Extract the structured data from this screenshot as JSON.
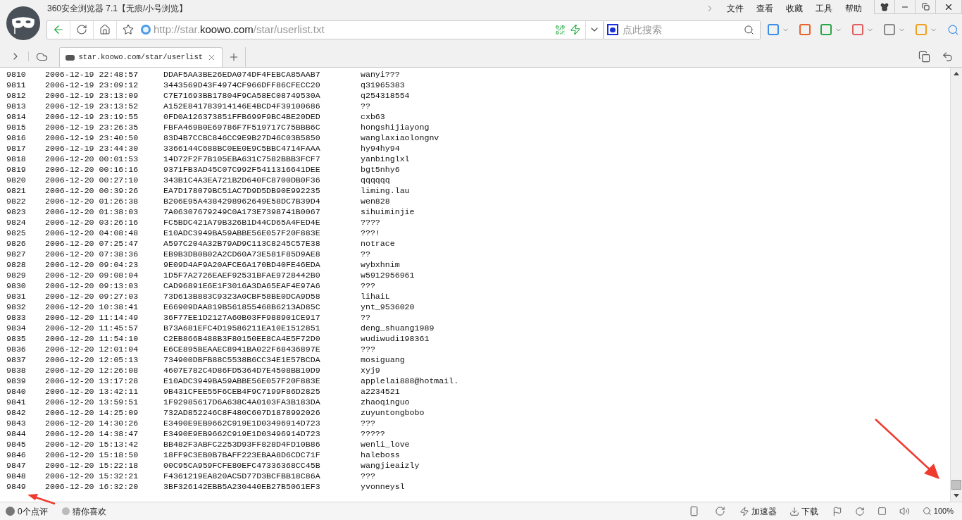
{
  "window": {
    "title": "360安全浏览器 7.1【无痕/小号浏览】"
  },
  "menu": [
    "文件",
    "查看",
    "收藏",
    "工具",
    "帮助"
  ],
  "address_bar": {
    "value_prefix": "http://star.",
    "value_domain": "koowo.com",
    "value_path": "/star/userlist.txt"
  },
  "search": {
    "placeholder": "点此搜索"
  },
  "tabs": [
    {
      "label": "star.koowo.com/star/userlist",
      "selected": true
    }
  ],
  "rows": [
    {
      "id": "9810",
      "time": "2006-12-19 22:48:57",
      "hash": "DDAF5AA3BE26EDA074DF4FEBCA85AAB7",
      "user": "wanyi???"
    },
    {
      "id": "9811",
      "time": "2006-12-19 23:09:12",
      "hash": "3443569D43F4974CF966DFF86CFECC20",
      "user": "q31965383"
    },
    {
      "id": "9812",
      "time": "2006-12-19 23:13:09",
      "hash": "C7E71693BB17804F9CA58EC08749530A",
      "user": "q254318554"
    },
    {
      "id": "9813",
      "time": "2006-12-19 23:13:52",
      "hash": "A152E841783914146E4BCD4F39100686",
      "user": "??"
    },
    {
      "id": "9814",
      "time": "2006-12-19 23:19:55",
      "hash": "0FD0A126373851FFB699F9BC4BE20DED",
      "user": "cxb63"
    },
    {
      "id": "9815",
      "time": "2006-12-19 23:26:35",
      "hash": "FBFA469B0E69786F7F519717C75BBB6C",
      "user": "hongshijiayong"
    },
    {
      "id": "9816",
      "time": "2006-12-19 23:40:50",
      "hash": "83D4B7CCBC846CC9E9B27D46C03B5850",
      "user": "wanglaxiaolongnv"
    },
    {
      "id": "9817",
      "time": "2006-12-19 23:44:30",
      "hash": "3366144C688BC0EE0E9C5BBC4714FAAA",
      "user": "hy94hy94"
    },
    {
      "id": "9818",
      "time": "2006-12-20 00:01:53",
      "hash": "14D72F2F7B105EBA631C7582BBB3FCF7",
      "user": "yanbinglxl"
    },
    {
      "id": "9819",
      "time": "2006-12-20 00:16:16",
      "hash": "9371FB3AD45C07C992F5411316641DEE",
      "user": "bgt5nhy6"
    },
    {
      "id": "9820",
      "time": "2006-12-20 00:27:10",
      "hash": "343B1C4A3EA721B2D640FC8700DB0F36",
      "user": "qqqqqq"
    },
    {
      "id": "9821",
      "time": "2006-12-20 00:39:26",
      "hash": "EA7D178079BC51AC7D9D5DB90E992235",
      "user": "liming.lau"
    },
    {
      "id": "9822",
      "time": "2006-12-20 01:26:38",
      "hash": "B206E95A4384298962649E58DC7B39D4",
      "user": "wen828"
    },
    {
      "id": "9823",
      "time": "2006-12-20 01:38:03",
      "hash": "7A06307679249C0A173E7398741B0067",
      "user": "sihuiminjie"
    },
    {
      "id": "9824",
      "time": "2006-12-20 03:26:16",
      "hash": "FC5BDC421A79B326B1D44CD65A4FED4E",
      "user": "????"
    },
    {
      "id": "9825",
      "time": "2006-12-20 04:08:48",
      "hash": "E10ADC3949BA59ABBE56E057F20F883E",
      "user": "???!"
    },
    {
      "id": "9826",
      "time": "2006-12-20 07:25:47",
      "hash": "A597C204A32B79AD9C113C8245C57E38",
      "user": "notrace"
    },
    {
      "id": "9827",
      "time": "2006-12-20 07:38:36",
      "hash": "EB9B3DB0B02A2CD60A73E581F85D9AE8",
      "user": "??"
    },
    {
      "id": "9828",
      "time": "2006-12-20 09:04:23",
      "hash": "9E09D4AF9A20AFCE6A170BD40FE46EDA",
      "user": "wybxhnim"
    },
    {
      "id": "9829",
      "time": "2006-12-20 09:08:04",
      "hash": "1D5F7A2726EAEF92531BFAE9728442B0",
      "user": "w5912956961"
    },
    {
      "id": "9830",
      "time": "2006-12-20 09:13:03",
      "hash": "CAD96891E6E1F3016A3DA65EAF4E97A6",
      "user": "???"
    },
    {
      "id": "9831",
      "time": "2006-12-20 09:27:03",
      "hash": "73D613B883C9323A0CBF58BE0DCA9D58",
      "user": "lihaiL"
    },
    {
      "id": "9832",
      "time": "2006-12-20 10:38:41",
      "hash": "E66909DAA819B561855468B6213AD85C",
      "user": "ynt_9536020"
    },
    {
      "id": "9833",
      "time": "2006-12-20 11:14:49",
      "hash": "36F77EE1D2127A60B03FF988901CE917",
      "user": "??"
    },
    {
      "id": "9834",
      "time": "2006-12-20 11:45:57",
      "hash": "B73A681EFC4D19586211EA10E1512851",
      "user": "deng_shuang1989"
    },
    {
      "id": "9835",
      "time": "2006-12-20 11:54:10",
      "hash": "C2EB866B488B3F80150EE8CA4E5F72D0",
      "user": "wudiwudi198361"
    },
    {
      "id": "9836",
      "time": "2006-12-20 12:01:04",
      "hash": "E6CE895BEAAEC8941BA022F68436897E",
      "user": "???"
    },
    {
      "id": "9837",
      "time": "2006-12-20 12:05:13",
      "hash": "734900DBFB88C5538B6CC34E1E57BCDA",
      "user": "mosiguang"
    },
    {
      "id": "9838",
      "time": "2006-12-20 12:26:08",
      "hash": "4607E782C4D86FD5364D7E4508BB10D9",
      "user": "xyj9"
    },
    {
      "id": "9839",
      "time": "2006-12-20 13:17:28",
      "hash": "E10ADC3949BA59ABBE56E057F20F883E",
      "user": "applelai888@hotmail."
    },
    {
      "id": "9840",
      "time": "2006-12-20 13:42:11",
      "hash": "9B431CFEE55F6CEB4F9C7199F86D2825",
      "user": "a2234521"
    },
    {
      "id": "9841",
      "time": "2006-12-20 13:59:51",
      "hash": "1F92985617D6A638C4A0103FA3B183DA",
      "user": "zhaoqinguo"
    },
    {
      "id": "9842",
      "time": "2006-12-20 14:25:09",
      "hash": "732AD852246C8F480C607D1878992026",
      "user": "zuyuntongbobo"
    },
    {
      "id": "9843",
      "time": "2006-12-20 14:30:26",
      "hash": "E3490E9EB9662C919E1D03496914D723",
      "user": "???"
    },
    {
      "id": "9844",
      "time": "2006-12-20 14:38:47",
      "hash": "E3490E9EB9662C919E1D03496914D723",
      "user": "?????"
    },
    {
      "id": "9845",
      "time": "2006-12-20 15:13:42",
      "hash": "BB482F3ABFC2253D93FF828D4FD10B86",
      "user": "wenli_love"
    },
    {
      "id": "9846",
      "time": "2006-12-20 15:18:50",
      "hash": "18FF9C3EB0B7BAFF223EBAA8D6CDC71F",
      "user": "haleboss"
    },
    {
      "id": "9847",
      "time": "2006-12-20 15:22:18",
      "hash": "00C95CA959FCFE80EFC47336368CC45B",
      "user": "wangjieaizly"
    },
    {
      "id": "9848",
      "time": "2006-12-20 15:32:21",
      "hash": "F4361219EA820AC5D77D3BCFBB18C86A",
      "user": "???"
    },
    {
      "id": "9849",
      "time": "2006-12-20 16:32:20",
      "hash": "3BF326142EBB5A230440EB27B5061EF3",
      "user": "yvonneysl"
    }
  ],
  "status_bar": {
    "left": [
      "0个点评",
      "猜你喜欢"
    ],
    "accelerator": "加速器",
    "download": "下载",
    "zoom": "100%"
  }
}
